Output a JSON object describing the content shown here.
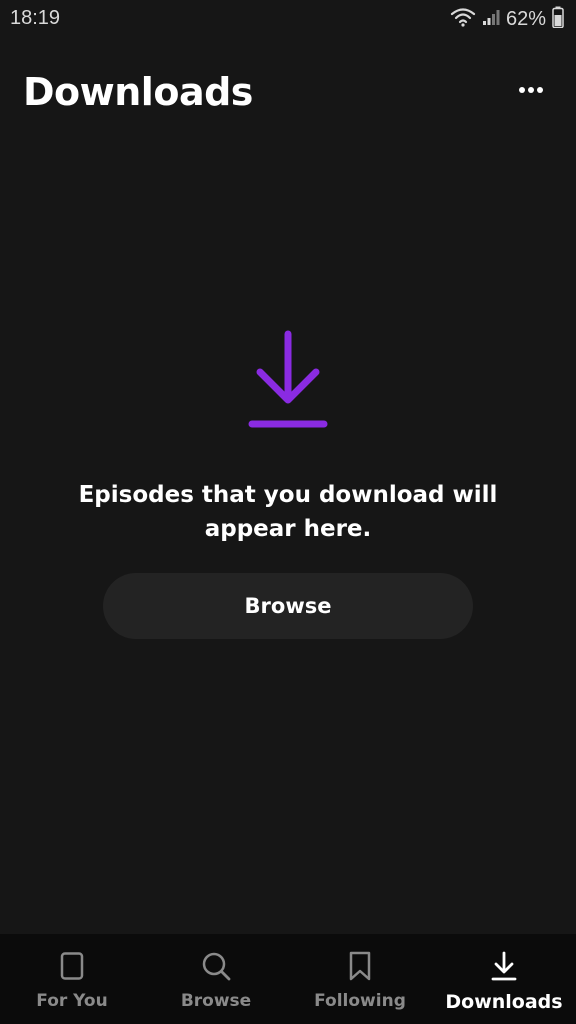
{
  "status_bar": {
    "time": "18:19",
    "battery": "62%"
  },
  "header": {
    "title": "Downloads"
  },
  "empty_state": {
    "message_line1": "Episodes that you download will",
    "message_line2": "appear here.",
    "button_label": "Browse",
    "icon": "download-icon",
    "accent_color": "#8a2be2"
  },
  "nav": {
    "items": [
      {
        "label": "For You",
        "icon": "phone-outline-icon",
        "active": false
      },
      {
        "label": "Browse",
        "icon": "search-icon",
        "active": false
      },
      {
        "label": "Following",
        "icon": "bookmark-icon",
        "active": false
      },
      {
        "label": "Downloads",
        "icon": "download-icon",
        "active": true
      }
    ]
  }
}
